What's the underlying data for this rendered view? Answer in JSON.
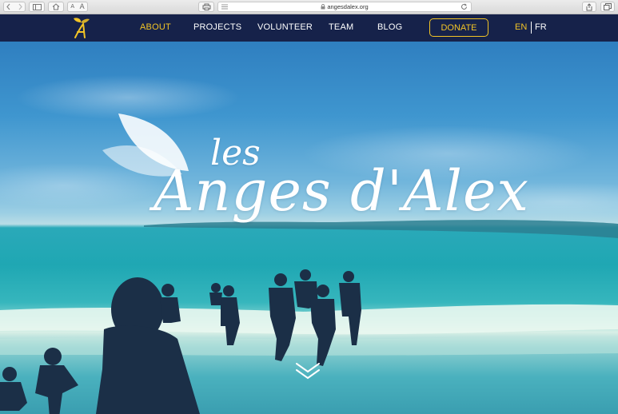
{
  "browser": {
    "url": "angesdalex.org",
    "font_small_label": "A",
    "font_large_label": "A",
    "icons": [
      "back-icon",
      "forward-icon",
      "sidebar-icon",
      "home-icon",
      "print-icon",
      "lock-icon",
      "reload-icon",
      "share-icon",
      "tabs-icon"
    ]
  },
  "nav": {
    "items": [
      {
        "label": "ABOUT",
        "active": true
      },
      {
        "label": "PROJECTS",
        "active": false
      },
      {
        "label": "VOLUNTEER",
        "active": false
      },
      {
        "label": "TEAM",
        "active": false
      },
      {
        "label": "BLOG",
        "active": false
      }
    ],
    "donate_label": "DONATE",
    "lang_en": "EN",
    "lang_fr": "FR",
    "accent_color": "#f2c426",
    "bar_color": "#16224a"
  },
  "hero": {
    "brand_les": "les",
    "brand_name": "Anges d'Alex",
    "scroll_icon": "double-chevron-down-icon"
  }
}
